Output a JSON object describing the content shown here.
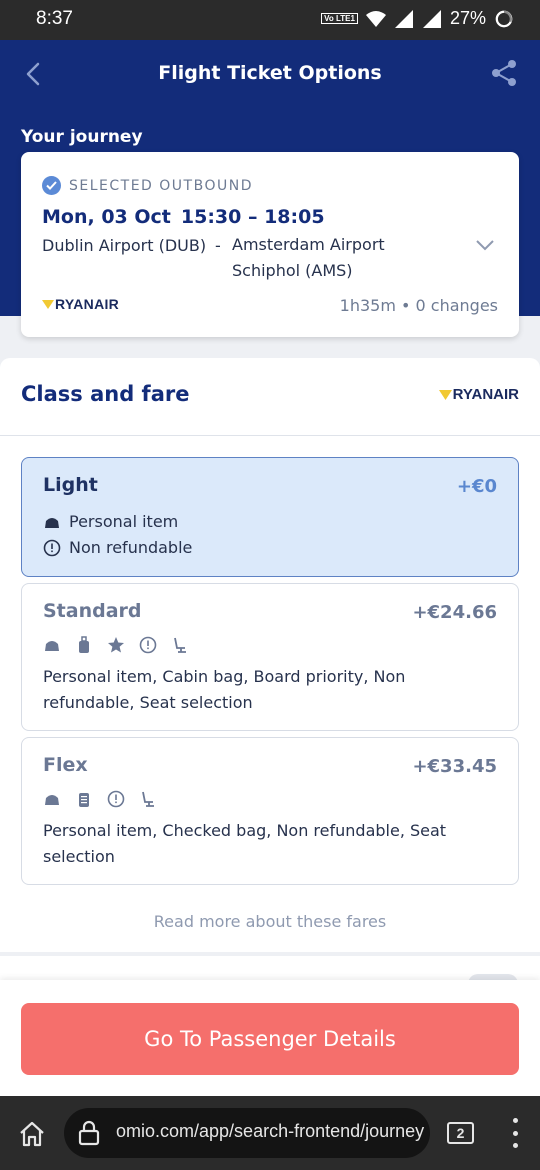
{
  "status_bar": {
    "time": "8:37",
    "volte_label": "Vo LTE1",
    "battery": "27%"
  },
  "header": {
    "title": "Flight Ticket Options",
    "journey_label": "Your journey"
  },
  "journey": {
    "selected_label": "SELECTED OUTBOUND",
    "date": "Mon, 03 Oct",
    "time": "15:30 – 18:05",
    "from": "Dublin Airport (DUB)",
    "separator": "-",
    "to": "Amsterdam Airport Schiphol (AMS)",
    "airline": "RYANAIR",
    "duration": "1h35m • 0 changes"
  },
  "fare_section": {
    "title": "Class and fare",
    "airline": "RYANAIR",
    "read_more": "Read more about these fares",
    "fares": [
      {
        "name": "Light",
        "price": "+€0",
        "selected": true,
        "features": [
          "Personal item",
          "Non refundable"
        ]
      },
      {
        "name": "Standard",
        "price": "+€24.66",
        "selected": false,
        "icons": [
          "personal-item-icon",
          "cabin-bag-icon",
          "star-icon",
          "info-icon",
          "seat-icon"
        ],
        "description": "Personal item, Cabin bag, Board priority, Non refundable, Seat selection"
      },
      {
        "name": "Flex",
        "price": "+€33.45",
        "selected": false,
        "icons": [
          "personal-item-icon",
          "checked-bag-icon",
          "info-icon",
          "seat-icon"
        ],
        "description": "Personal item, Checked bag, Non refundable, Seat selection"
      }
    ]
  },
  "cta": {
    "label": "Go To Passenger Details"
  },
  "browser": {
    "url": "omio.com/app/search-frontend/journey",
    "tab_count": "2"
  },
  "colors": {
    "header_bg": "#132c7a",
    "cta_bg": "#f56f6c",
    "selected_fare_bg": "#dbe9fa",
    "accent": "#5a87cf"
  }
}
